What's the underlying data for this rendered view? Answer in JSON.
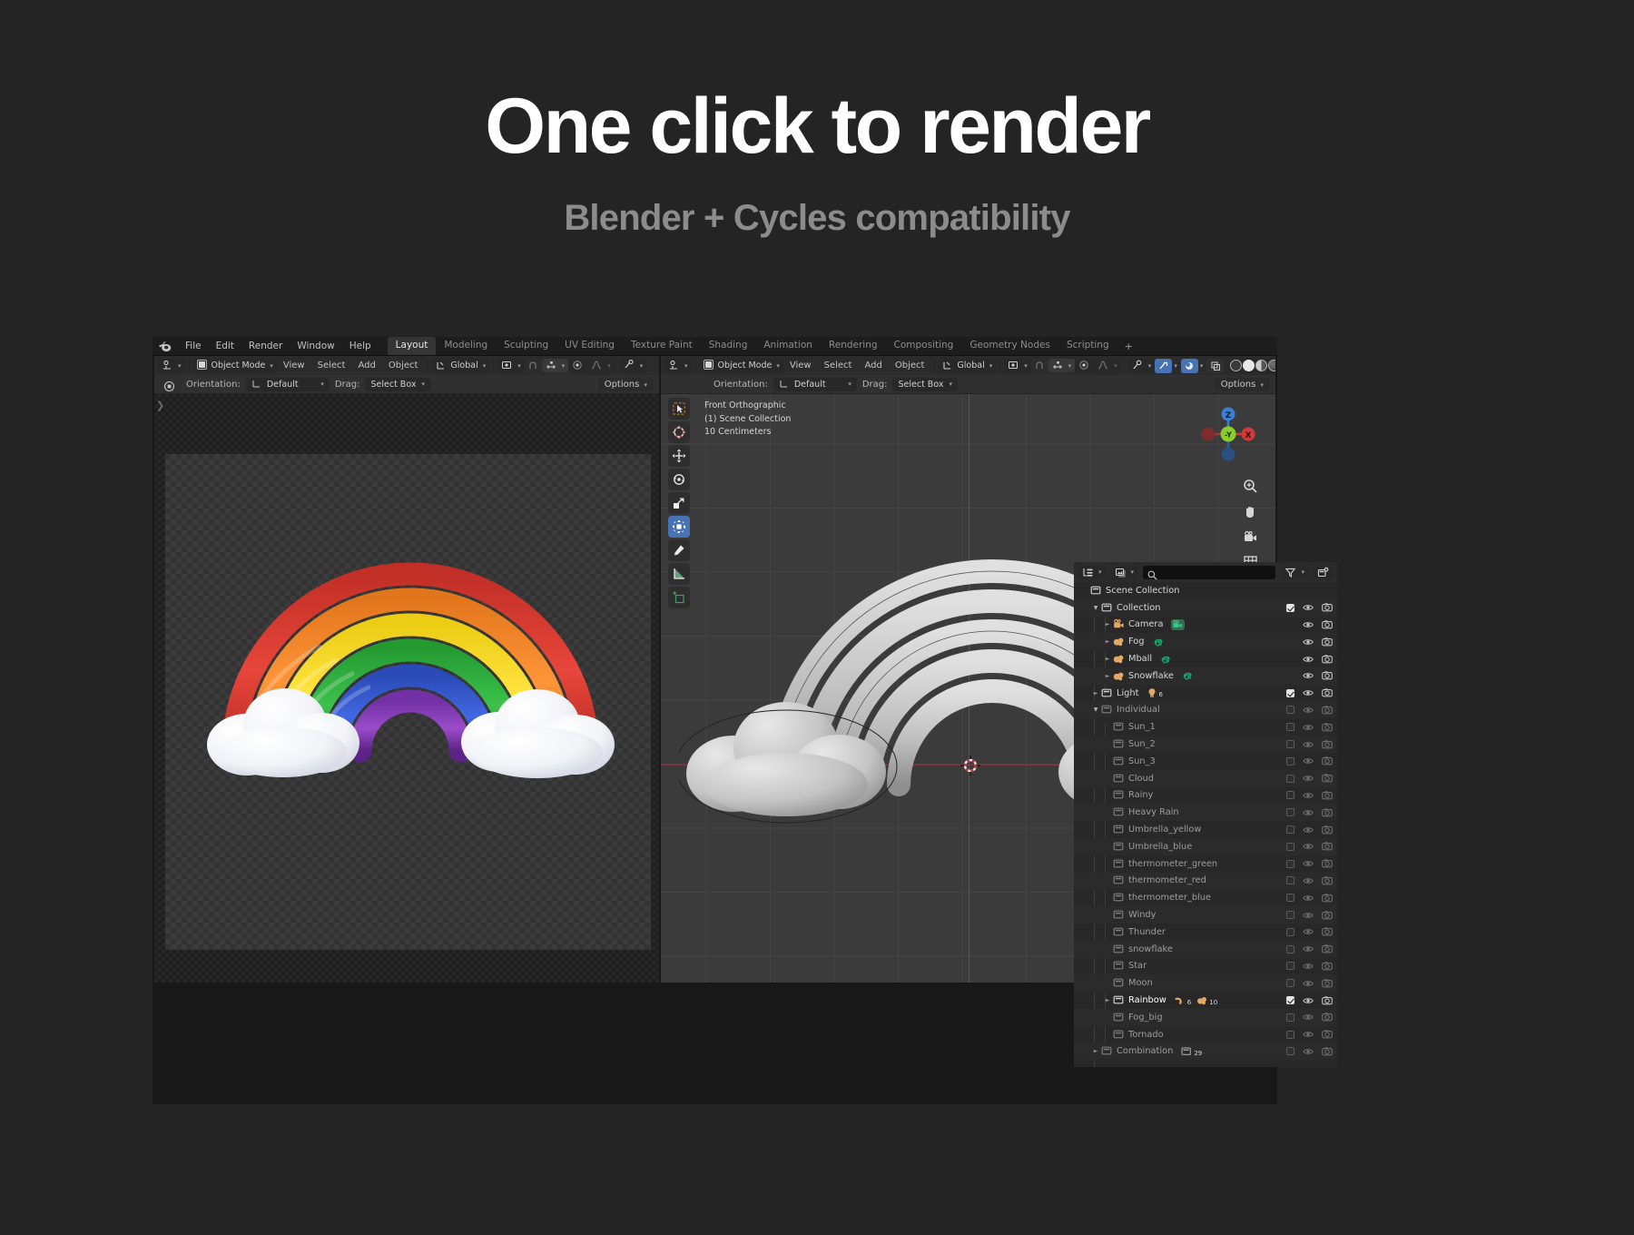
{
  "hero": {
    "title": "One click to render",
    "subtitle": "Blender + Cycles compatibility"
  },
  "colors": {
    "accent_blue": "#4772b3",
    "app_bg": "#181818",
    "header_bg": "#2b2b2b",
    "viewport_bg": "#3b3b3b",
    "outliner_bg": "#282828",
    "collection_orange": "#e5a764",
    "mesh_green": "#00a34a",
    "page_bg": "#242424",
    "axis_x_red": "#7b3b42",
    "axis_z_blue": "#3b5a7b"
  },
  "topbar": {
    "logo_icon": "blender-logo-icon",
    "menus": [
      "File",
      "Edit",
      "Render",
      "Window",
      "Help"
    ],
    "workspaces": [
      {
        "label": "Layout",
        "active": true
      },
      {
        "label": "Modeling",
        "active": false
      },
      {
        "label": "Sculpting",
        "active": false
      },
      {
        "label": "UV Editing",
        "active": false
      },
      {
        "label": "Texture Paint",
        "active": false
      },
      {
        "label": "Shading",
        "active": false
      },
      {
        "label": "Animation",
        "active": false
      },
      {
        "label": "Rendering",
        "active": false
      },
      {
        "label": "Compositing",
        "active": false
      },
      {
        "label": "Geometry Nodes",
        "active": false
      },
      {
        "label": "Scripting",
        "active": false
      }
    ],
    "add_workspace": "+"
  },
  "left_editor": {
    "editor_type_icon": "editor-type-icon",
    "mode": "Object Mode",
    "menus": [
      "View",
      "Select",
      "Add",
      "Object"
    ],
    "transform_orientation": "Global",
    "tool_settings": {
      "orientation_label": "Orientation:",
      "orientation_value": "Default",
      "drag_label": "Drag:",
      "drag_value": "Select Box"
    },
    "options_label": "Options",
    "sidebar_arrow": "❯"
  },
  "right_editor": {
    "editor_type_icon": "editor-type-icon",
    "mode": "Object Mode",
    "menus": [
      "View",
      "Select",
      "Add",
      "Object"
    ],
    "transform_orientation": "Global",
    "tool_settings": {
      "orientation_label": "Orientation:",
      "orientation_value": "Default",
      "drag_label": "Drag:",
      "drag_value": "Select Box"
    },
    "options_label": "Options",
    "viewport_info": {
      "view_name": "Front Orthographic",
      "scene_collection": "(1) Scene Collection",
      "grid_scale": "10 Centimeters"
    },
    "gizmo_axes": {
      "z": "Z",
      "y": "-Y",
      "x": "X"
    },
    "toolbar": [
      {
        "name": "tweak-tool",
        "selected": false
      },
      {
        "name": "cursor-tool",
        "selected": false
      },
      {
        "name": "move-tool",
        "selected": false
      },
      {
        "name": "rotate-tool",
        "selected": false
      },
      {
        "name": "scale-tool",
        "selected": false
      },
      {
        "name": "transform-tool",
        "selected": true
      },
      {
        "name": "annotate-tool",
        "selected": false
      },
      {
        "name": "measure-tool",
        "selected": false
      },
      {
        "name": "add-cube-tool",
        "selected": false
      }
    ],
    "nav_buttons": [
      "zoom-icon",
      "pan-hand-icon",
      "camera-view-icon",
      "toggle-ortho-icon"
    ]
  },
  "outliner": {
    "display_mode_icon": "outliner-display-mode-icon",
    "filter_id_icon": "id-type-filter-icon",
    "search_placeholder": "",
    "search_value": "",
    "filter_icon": "funnel-filter-icon",
    "new_collection_icon": "new-collection-icon",
    "columns": {
      "checkbox": "selectable",
      "eye": "hide-in-viewport",
      "camera": "disable-in-render"
    },
    "tree": [
      {
        "label": "Scene Collection",
        "indent": 0,
        "icon": "collection-icon",
        "tri": "none",
        "checkbox": "none",
        "eye": false,
        "camera": false,
        "dim": false,
        "badges": []
      },
      {
        "label": "Collection",
        "indent": 1,
        "icon": "collection-icon",
        "tri": "open",
        "checkbox": "checked",
        "eye": true,
        "camera": true,
        "dim": false,
        "badges": []
      },
      {
        "label": "Camera",
        "indent": 2,
        "icon": "camera-data-icon",
        "tri": "closed",
        "checkbox": "none",
        "eye": true,
        "camera": true,
        "dim": false,
        "badges": [
          {
            "icon": "camera-data-badge",
            "count": ""
          }
        ]
      },
      {
        "label": "Fog",
        "indent": 2,
        "icon": "metaball-icon",
        "tri": "closed",
        "checkbox": "none",
        "eye": true,
        "camera": true,
        "dim": false,
        "badges": [
          {
            "icon": "metaball-data-badge",
            "count": ""
          }
        ]
      },
      {
        "label": "Mball",
        "indent": 2,
        "icon": "metaball-icon",
        "tri": "closed",
        "checkbox": "none",
        "eye": true,
        "camera": true,
        "dim": false,
        "badges": [
          {
            "icon": "metaball-data-badge",
            "count": ""
          }
        ]
      },
      {
        "label": "Snowflake",
        "indent": 2,
        "icon": "metaball-icon",
        "tri": "closed",
        "checkbox": "none",
        "eye": true,
        "camera": true,
        "dim": false,
        "badges": [
          {
            "icon": "metaball-data-badge",
            "count": ""
          }
        ]
      },
      {
        "label": "Light",
        "indent": 1,
        "icon": "collection-icon",
        "tri": "closed",
        "checkbox": "checked",
        "eye": true,
        "camera": true,
        "dim": false,
        "badges": [
          {
            "icon": "light-badge",
            "count": "6"
          }
        ]
      },
      {
        "label": "Individual",
        "indent": 1,
        "icon": "collection-icon",
        "tri": "open",
        "checkbox": "unchecked",
        "eye": true,
        "camera": true,
        "dim": true,
        "badges": []
      },
      {
        "label": "Sun_1",
        "indent": 2,
        "icon": "collection-icon",
        "tri": "none",
        "checkbox": "unchecked",
        "eye": true,
        "camera": true,
        "dim": true,
        "badges": []
      },
      {
        "label": "Sun_2",
        "indent": 2,
        "icon": "collection-icon",
        "tri": "none",
        "checkbox": "unchecked",
        "eye": true,
        "camera": true,
        "dim": true,
        "badges": []
      },
      {
        "label": "Sun_3",
        "indent": 2,
        "icon": "collection-icon",
        "tri": "none",
        "checkbox": "unchecked",
        "eye": true,
        "camera": true,
        "dim": true,
        "badges": []
      },
      {
        "label": "Cloud",
        "indent": 2,
        "icon": "collection-icon",
        "tri": "none",
        "checkbox": "unchecked",
        "eye": true,
        "camera": true,
        "dim": true,
        "badges": []
      },
      {
        "label": "Rainy",
        "indent": 2,
        "icon": "collection-icon",
        "tri": "none",
        "checkbox": "unchecked",
        "eye": true,
        "camera": true,
        "dim": true,
        "badges": []
      },
      {
        "label": "Heavy Rain",
        "indent": 2,
        "icon": "collection-icon",
        "tri": "none",
        "checkbox": "unchecked",
        "eye": true,
        "camera": true,
        "dim": true,
        "badges": []
      },
      {
        "label": "Umbrella_yellow",
        "indent": 2,
        "icon": "collection-icon",
        "tri": "none",
        "checkbox": "unchecked",
        "eye": true,
        "camera": true,
        "dim": true,
        "badges": []
      },
      {
        "label": "Umbrella_blue",
        "indent": 2,
        "icon": "collection-icon",
        "tri": "none",
        "checkbox": "unchecked",
        "eye": true,
        "camera": true,
        "dim": true,
        "badges": []
      },
      {
        "label": "thermometer_green",
        "indent": 2,
        "icon": "collection-icon",
        "tri": "none",
        "checkbox": "unchecked",
        "eye": true,
        "camera": true,
        "dim": true,
        "badges": []
      },
      {
        "label": "thermometer_red",
        "indent": 2,
        "icon": "collection-icon",
        "tri": "none",
        "checkbox": "unchecked",
        "eye": true,
        "camera": true,
        "dim": true,
        "badges": []
      },
      {
        "label": "thermometer_blue",
        "indent": 2,
        "icon": "collection-icon",
        "tri": "none",
        "checkbox": "unchecked",
        "eye": true,
        "camera": true,
        "dim": true,
        "badges": []
      },
      {
        "label": "Windy",
        "indent": 2,
        "icon": "collection-icon",
        "tri": "none",
        "checkbox": "unchecked",
        "eye": true,
        "camera": true,
        "dim": true,
        "badges": []
      },
      {
        "label": "Thunder",
        "indent": 2,
        "icon": "collection-icon",
        "tri": "none",
        "checkbox": "unchecked",
        "eye": true,
        "camera": true,
        "dim": true,
        "badges": []
      },
      {
        "label": "snowflake",
        "indent": 2,
        "icon": "collection-icon",
        "tri": "none",
        "checkbox": "unchecked",
        "eye": true,
        "camera": true,
        "dim": true,
        "badges": []
      },
      {
        "label": "Star",
        "indent": 2,
        "icon": "collection-icon",
        "tri": "none",
        "checkbox": "unchecked",
        "eye": true,
        "camera": true,
        "dim": true,
        "badges": []
      },
      {
        "label": "Moon",
        "indent": 2,
        "icon": "collection-icon",
        "tri": "none",
        "checkbox": "unchecked",
        "eye": true,
        "camera": true,
        "dim": true,
        "badges": []
      },
      {
        "label": "Rainbow",
        "indent": 2,
        "icon": "collection-icon",
        "tri": "closed",
        "checkbox": "checked",
        "eye": true,
        "camera": true,
        "dim": false,
        "badges": [
          {
            "icon": "curve-badge",
            "count": "6"
          },
          {
            "icon": "metaball-badge",
            "count": "10"
          }
        ]
      },
      {
        "label": "Fog_big",
        "indent": 2,
        "icon": "collection-icon",
        "tri": "none",
        "checkbox": "unchecked",
        "eye": true,
        "camera": true,
        "dim": true,
        "badges": []
      },
      {
        "label": "Tornado",
        "indent": 2,
        "icon": "collection-icon",
        "tri": "none",
        "checkbox": "unchecked",
        "eye": true,
        "camera": true,
        "dim": true,
        "badges": []
      },
      {
        "label": "Combination",
        "indent": 1,
        "icon": "collection-icon",
        "tri": "closed",
        "checkbox": "unchecked",
        "eye": true,
        "camera": true,
        "dim": true,
        "badges": [
          {
            "icon": "collection-badge",
            "count": "29"
          }
        ]
      }
    ]
  },
  "artwork": {
    "left_preview": "rainbow-with-clouds-render",
    "right_viewport": "rainbow-with-clouds-solid-shading",
    "rainbow_colors": [
      "#d8352c",
      "#ef7b22",
      "#f2d118",
      "#27a335",
      "#2b53c4",
      "#7e37b0"
    ]
  }
}
